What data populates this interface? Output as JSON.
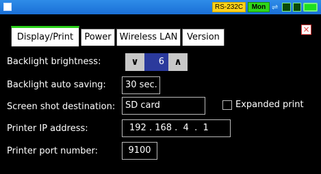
{
  "status": {
    "rs232_label": "RS-232C",
    "mon_label": "Mon"
  },
  "tabs": [
    {
      "label": "Display/Print"
    },
    {
      "label": "Power"
    },
    {
      "label": "Wireless LAN"
    },
    {
      "label": "Version"
    }
  ],
  "close_symbol": "×",
  "fields": {
    "backlight_brightness": {
      "label": "Backlight brightness:",
      "value": "6",
      "down": "∨",
      "up": "∧"
    },
    "backlight_auto_saving": {
      "label": "Backlight auto saving:",
      "value": "30 sec."
    },
    "screenshot_destination": {
      "label": "Screen shot destination:",
      "value": "SD card"
    },
    "expanded_print": {
      "label": "Expanded print",
      "checked": false
    },
    "printer_ip": {
      "label": "Printer IP address:",
      "value": "192 . 168 .  4  .  1"
    },
    "printer_port": {
      "label": "Printer port number:",
      "value": "9100"
    }
  }
}
